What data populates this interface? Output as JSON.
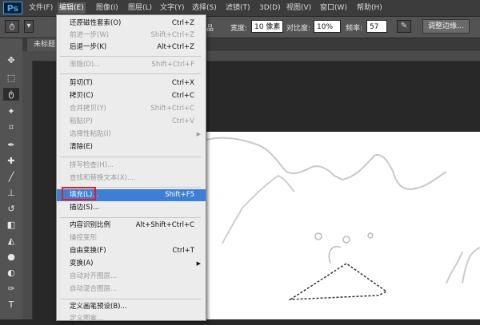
{
  "menubar": {
    "logo": "Ps",
    "items": [
      {
        "label": "文件(F)"
      },
      {
        "label": "编辑(E)"
      },
      {
        "label": "图像(I)"
      },
      {
        "label": "图层(L)"
      },
      {
        "label": "文字(Y)"
      },
      {
        "label": "选择(S)"
      },
      {
        "label": "滤镜(T)"
      },
      {
        "label": "3D(D)"
      },
      {
        "label": "视图(V)"
      },
      {
        "label": "窗口(W)"
      },
      {
        "label": "帮助(H)"
      }
    ]
  },
  "options": {
    "partial_label": "品",
    "width_label": "宽度:",
    "width_value": "10 像素",
    "contrast_label": "对比度:",
    "contrast_value": "10%",
    "frequency_label": "频率:",
    "frequency_value": "57",
    "refine_edge_label": "调整边缘..."
  },
  "document": {
    "tab_label": "未标题"
  },
  "edit_menu": {
    "items": [
      {
        "label": "还原磁性套索(O)",
        "shortcut": "Ctrl+Z",
        "disabled": false
      },
      {
        "label": "前进一步(W)",
        "shortcut": "Shift+Ctrl+Z",
        "disabled": true
      },
      {
        "label": "后退一步(K)",
        "shortcut": "Alt+Ctrl+Z",
        "disabled": false
      },
      {
        "label": "渐隐(D)...",
        "shortcut": "Shift+Ctrl+F",
        "disabled": true
      },
      {
        "label": "剪切(T)",
        "shortcut": "Ctrl+X",
        "disabled": false
      },
      {
        "label": "拷贝(C)",
        "shortcut": "Ctrl+C",
        "disabled": false
      },
      {
        "label": "合并拷贝(Y)",
        "shortcut": "Shift+Ctrl+C",
        "disabled": true
      },
      {
        "label": "粘贴(P)",
        "shortcut": "Ctrl+V",
        "disabled": true
      },
      {
        "label": "选择性粘贴(I)",
        "shortcut": "",
        "disabled": true
      },
      {
        "label": "清除(E)",
        "shortcut": "",
        "disabled": false
      },
      {
        "label": "拼写检查(H)...",
        "shortcut": "",
        "disabled": true
      },
      {
        "label": "查找和替换文本(X)...",
        "shortcut": "",
        "disabled": true
      },
      {
        "label": "填充(L)...",
        "shortcut": "Shift+F5",
        "disabled": false
      },
      {
        "label": "描边(S)...",
        "shortcut": "",
        "disabled": false
      },
      {
        "label": "内容识别比例",
        "shortcut": "Alt+Shift+Ctrl+C",
        "disabled": false
      },
      {
        "label": "操控变形",
        "shortcut": "",
        "disabled": true
      },
      {
        "label": "自由变换(F)",
        "shortcut": "Ctrl+T",
        "disabled": false
      },
      {
        "label": "变换(A)",
        "shortcut": "",
        "disabled": false
      },
      {
        "label": "自动对齐图层...",
        "shortcut": "",
        "disabled": true
      },
      {
        "label": "自动混合图层...",
        "shortcut": "",
        "disabled": true
      },
      {
        "label": "定义画笔预设(B)...",
        "shortcut": "",
        "disabled": false
      },
      {
        "label": "定义图案...",
        "shortcut": "",
        "disabled": true
      }
    ]
  },
  "colors": {
    "highlight": "#3e7fd6",
    "annotation_box": "#e02020"
  }
}
